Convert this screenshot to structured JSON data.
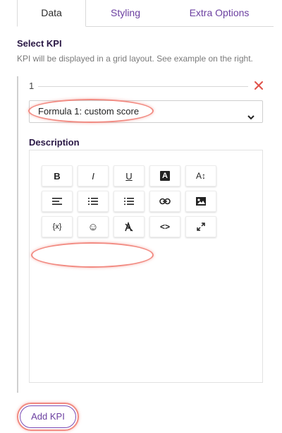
{
  "tabs": [
    {
      "label": "Data",
      "active": true
    },
    {
      "label": "Styling",
      "active": false
    },
    {
      "label": "Extra Options",
      "active": false
    }
  ],
  "select_kpi": {
    "title": "Select KPI",
    "hint": "KPI will be displayed in a grid layout. See example on the right."
  },
  "kpi": {
    "index": "1",
    "selected_formula": "Formula 1: custom score",
    "description_label": "Description",
    "remove_icon": "close-icon"
  },
  "toolbar": {
    "buttons": [
      {
        "name": "bold",
        "label": "B"
      },
      {
        "name": "italic",
        "label": "I"
      },
      {
        "name": "underline",
        "label": "U"
      },
      {
        "name": "text-color",
        "label": "A"
      },
      {
        "name": "font-size",
        "label": "A↕"
      },
      {
        "name": "align-left",
        "label": ""
      },
      {
        "name": "ordered-list",
        "label": ""
      },
      {
        "name": "bullet-list",
        "label": ""
      },
      {
        "name": "link",
        "label": ""
      },
      {
        "name": "image",
        "label": ""
      },
      {
        "name": "variable",
        "label": "{x}"
      },
      {
        "name": "emoji",
        "label": "☺"
      },
      {
        "name": "clear-format",
        "label": ""
      },
      {
        "name": "code",
        "label": "<>"
      },
      {
        "name": "fullscreen",
        "label": ""
      }
    ]
  },
  "actions": {
    "add_kpi": "Add KPI"
  },
  "colors": {
    "accent": "#6b3fa0",
    "highlight": "#f28b82",
    "remove": "#e0524a"
  }
}
